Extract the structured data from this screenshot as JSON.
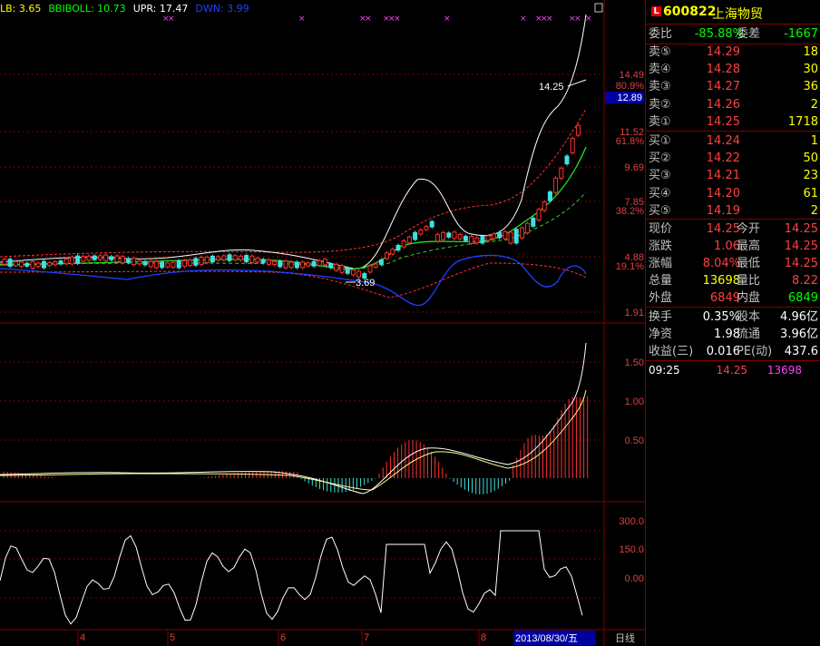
{
  "indicator": {
    "lb_label": "LB: 3.65",
    "bbiboll_label": "BBIBOLL: 10.73",
    "upr_label": "UPR: 17.47",
    "dwn_label": "DWN: 3.99",
    "colors": {
      "lb": "#ffff00",
      "bbiboll": "#00ff00",
      "upr": "#ffffff",
      "dwn": "#2040ff"
    }
  },
  "price_axis": {
    "labels": [
      "14.49",
      "11.52",
      "9.69",
      "7.85",
      "4.88",
      "1.91"
    ],
    "ref_box": "12.89"
  },
  "fib_labels": [
    "80.9%",
    "61.8%",
    "38.2%",
    "19.1%"
  ],
  "annotations": {
    "high": "14.25",
    "low": "3.69"
  },
  "macd_axis": [
    "1.50",
    "1.00",
    "0.50"
  ],
  "cci_axis": [
    "300.0",
    "150.0",
    "0.00"
  ],
  "time_axis": {
    "labels": [
      "4",
      "5",
      "6",
      "7",
      "8"
    ],
    "date_box": "2013/08/30/五",
    "period": "日线"
  },
  "quote": {
    "logo": "L",
    "code": "600822",
    "name": "上海物贸",
    "wei_bi_label": "委比",
    "wei_bi": "-85.88%",
    "wei_cha_label": "委差",
    "wei_cha": "-1667",
    "sell": [
      {
        "label": "卖⑤",
        "price": "14.29",
        "vol": "18"
      },
      {
        "label": "卖④",
        "price": "14.28",
        "vol": "30"
      },
      {
        "label": "卖③",
        "price": "14.27",
        "vol": "36"
      },
      {
        "label": "卖②",
        "price": "14.26",
        "vol": "2"
      },
      {
        "label": "卖①",
        "price": "14.25",
        "vol": "1718"
      }
    ],
    "buy": [
      {
        "label": "买①",
        "price": "14.24",
        "vol": "1"
      },
      {
        "label": "买②",
        "price": "14.22",
        "vol": "50"
      },
      {
        "label": "买③",
        "price": "14.21",
        "vol": "23"
      },
      {
        "label": "买④",
        "price": "14.20",
        "vol": "61"
      },
      {
        "label": "买⑤",
        "price": "14.19",
        "vol": "2"
      }
    ],
    "stats": [
      {
        "l1": "现价",
        "v1": "14.25",
        "l2": "今开",
        "v2": "14.25"
      },
      {
        "l1": "涨跌",
        "v1": "1.06",
        "l2": "最高",
        "v2": "14.25"
      },
      {
        "l1": "涨幅",
        "v1": "8.04%",
        "l2": "最低",
        "v2": "14.25"
      },
      {
        "l1": "总量",
        "v1": "13698",
        "l2": "量比",
        "v2": "8.22"
      },
      {
        "l1": "外盘",
        "v1": "6849",
        "l2": "内盘",
        "v2": "6849"
      }
    ],
    "stats2": [
      {
        "l1": "换手",
        "v1": "0.35%",
        "l2": "股本",
        "v2": "4.96亿"
      },
      {
        "l1": "净资",
        "v1": "1.98",
        "l2": "流通",
        "v2": "3.96亿"
      },
      {
        "l1": "收益(三)",
        "v1": "0.016",
        "l2": "PE(动)",
        "v2": "437.6"
      }
    ],
    "tick": {
      "time": "09:25",
      "price": "14.25",
      "vol": "13698"
    }
  }
}
